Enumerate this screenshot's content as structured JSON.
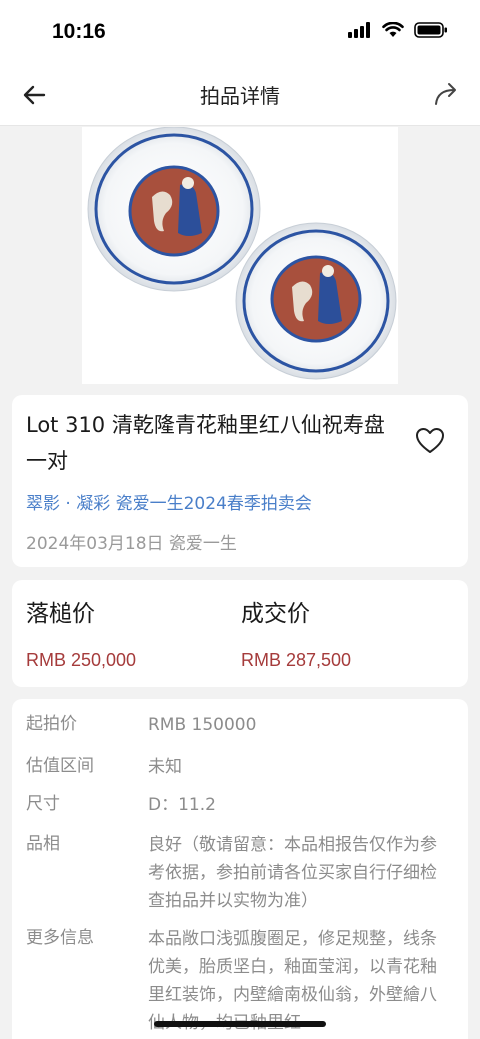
{
  "status": {
    "time": "10:16"
  },
  "nav": {
    "title": "拍品详情"
  },
  "gallery": {
    "dot_count": 15,
    "active_index": 0
  },
  "lot": {
    "title": "Lot 310 清乾隆青花釉里红八仙祝寿盘一对",
    "auction": "翠影 · 凝彩 瓷爱一生2024春季拍卖会",
    "date_line": "2024年03月18日 瓷爱一生"
  },
  "prices": {
    "hammer_label": "落槌价",
    "hammer_value": "RMB 250,000",
    "deal_label": "成交价",
    "deal_value": "RMB 287,500"
  },
  "info": [
    {
      "key": "起拍价",
      "value": "RMB 150000"
    },
    {
      "key": "估值区间",
      "value": "未知"
    },
    {
      "key": "尺寸",
      "value": "D：11.2"
    },
    {
      "key": "品相",
      "value": "良好（敬请留意：本品相报告仅作为参考依据，参拍前请各位买家自行仔细检查拍品并以实物为准）"
    },
    {
      "key": "更多信息",
      "value": "本品敞口浅弧腹圈足，修足规整，线条优美，胎质坚白，釉面莹润，以青花釉里红装饰，内壁繪南极仙翁，外壁繪八仙人物，均已釉里红"
    }
  ],
  "colors": {
    "accent_blue": "#3e7bd8",
    "price_red": "#a53b3b",
    "link_blue": "#4a7fc9"
  }
}
